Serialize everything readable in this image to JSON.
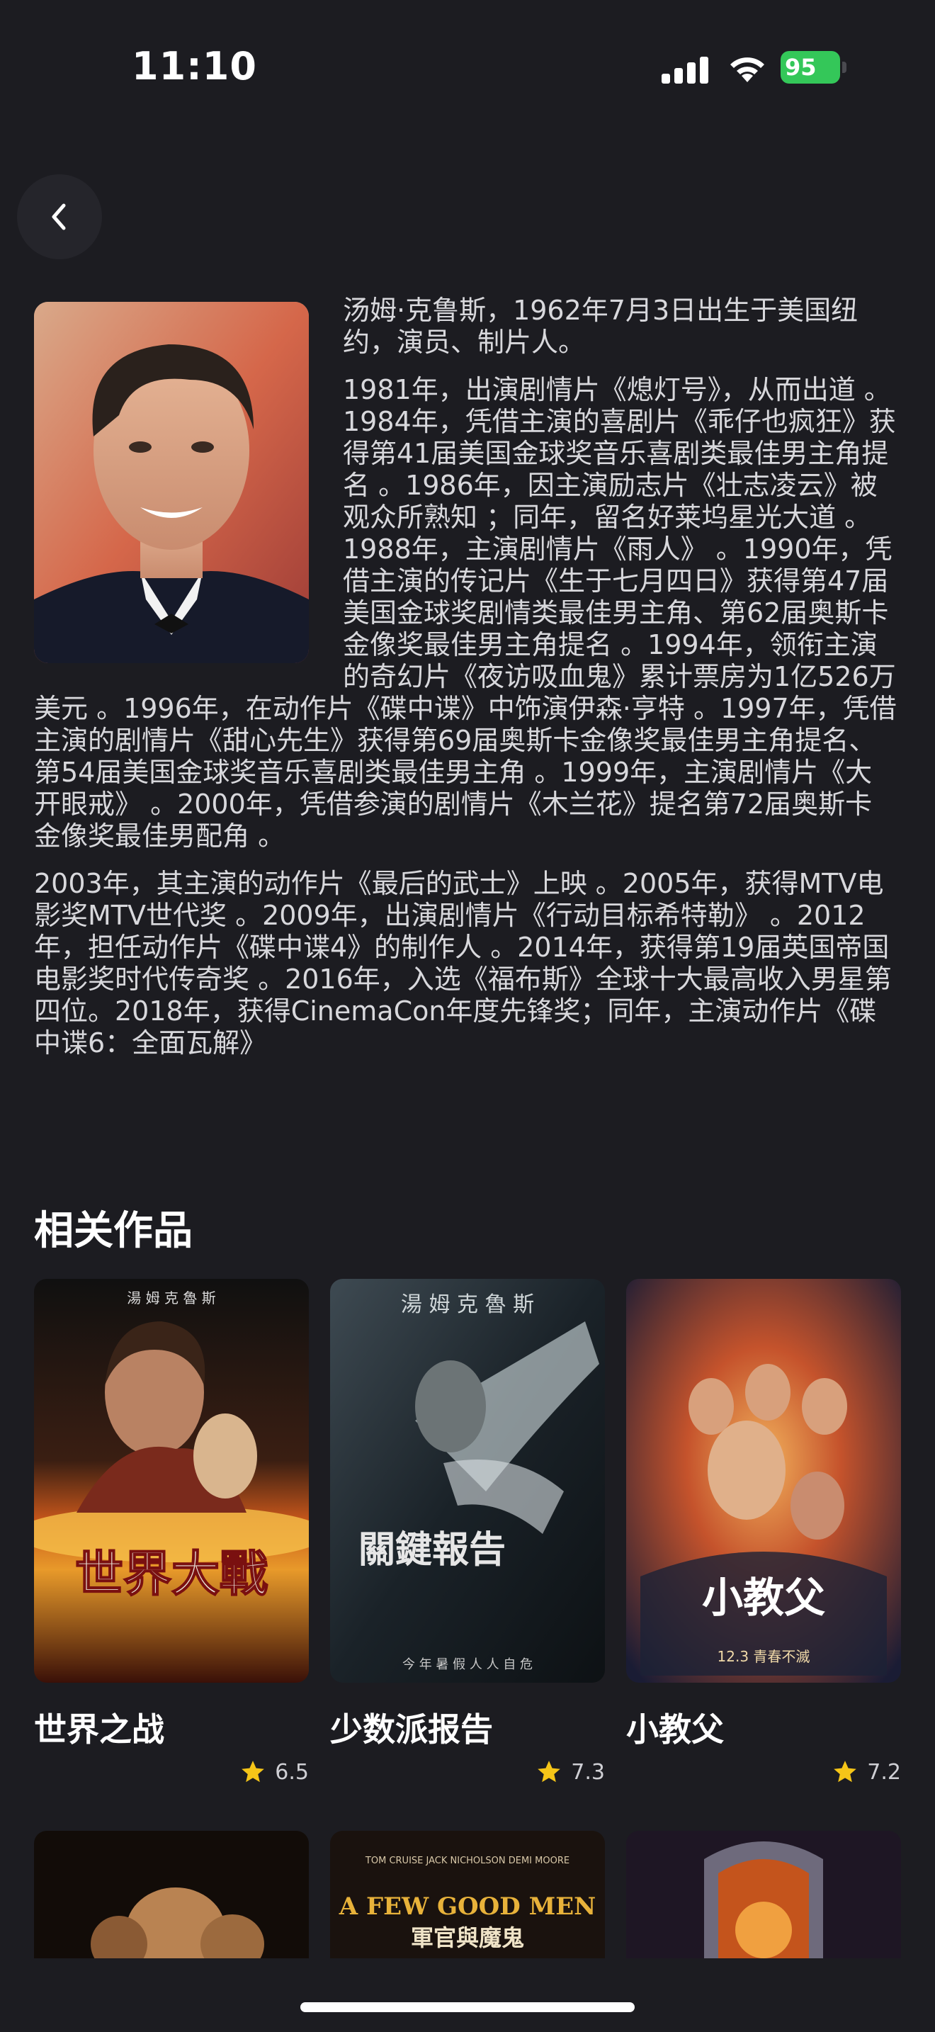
{
  "status_bar": {
    "time": "11:10",
    "battery": "95"
  },
  "bio": {
    "paragraphs": [
      "汤姆·克鲁斯，1962年7月3日出生于美国纽约，演员、制片人。",
      "1981年，出演剧情片《熄灯号》，从而出道 。1984年，凭借主演的喜剧片《乖仔也疯狂》获得第41届美国金球奖音乐喜剧类最佳男主角提名 。1986年，因主演励志片《壮志凌云》被观众所熟知 ；同年，留名好莱坞星光大道 。1988年，主演剧情片《雨人》 。1990年，凭借主演的传记片《生于七月四日》获得第47届美国金球奖剧情类最佳男主角、第62届奥斯卡金像奖最佳男主角提名 。1994年，领衔主演的奇幻片《夜访吸血鬼》累计票房为1亿526万美元 。1996年，在动作片《碟中谍》中饰演伊森·亨特 。1997年，凭借主演的剧情片《甜心先生》获得第69届奥斯卡金像奖最佳男主角提名、第54届美国金球奖音乐喜剧类最佳男主角 。1999年，主演剧情片《大开眼戒》 。2000年，凭借参演的剧情片《木兰花》提名第72届奥斯卡金像奖最佳男配角 。",
      "2003年，其主演的动作片《最后的武士》上映 。2005年，获得MTV电影奖MTV世代奖 。2009年，出演剧情片《行动目标希特勒》 。2012年，担任动作片《碟中谍4》的制作人 。2014年，获得第19届英国帝国电影奖时代传奇奖 。2016年，入选《福布斯》全球十大最高收入男星第四位。2018年，获得CinemaCon年度先锋奖；同年，主演动作片《碟中谍6：全面瓦解》"
    ]
  },
  "related": {
    "title": "相关作品",
    "works": [
      {
        "title": "世界之战",
        "rating": "6.5",
        "poster_text": "世界大戰",
        "poster_top": "湯 姆 克 魯 斯"
      },
      {
        "title": "少数派报告",
        "rating": "7.3",
        "poster_text": "關鍵報告",
        "poster_top": "湯 姆 克 魯 斯",
        "poster_bottom": "今 年 暑 假 人 人 自 危"
      },
      {
        "title": "小教父",
        "rating": "7.2",
        "poster_text": "小教父",
        "poster_bottom": "12.3 青春不滅"
      }
    ],
    "row2": [
      {
        "poster_text": ""
      },
      {
        "poster_text": "A FEW GOOD MEN",
        "poster_sub": "軍官與魔鬼",
        "poster_names": "TOM CRUISE    JACK NICHOLSON    DEMI MOORE"
      },
      {
        "poster_text": ""
      }
    ]
  },
  "colors": {
    "background": "#1c1c21",
    "star": "#f5c518",
    "battery": "#34c759"
  },
  "icons": [
    "back-chevron-icon",
    "signal-icon",
    "wifi-icon",
    "battery-icon",
    "star-icon"
  ]
}
